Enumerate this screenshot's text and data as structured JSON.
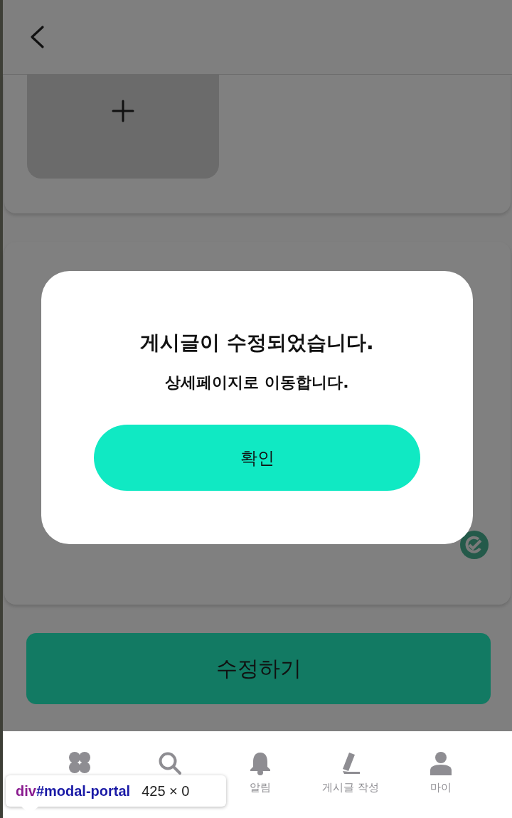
{
  "submit_button": {
    "label": "수정하기"
  },
  "modal": {
    "title": "게시글이 수정되었습니다.",
    "message": "상세페이지로 이동합니다.",
    "confirm": "확인"
  },
  "bottom_nav": [
    {
      "kind": "home"
    },
    {
      "kind": "search"
    },
    {
      "kind": "bell",
      "label": "알림"
    },
    {
      "kind": "pencil",
      "label": "게시글 작성"
    },
    {
      "kind": "person",
      "label": "마이"
    }
  ],
  "inspector_tooltip": {
    "tag": "div",
    "id": "#modal-portal",
    "size": "425 × 0"
  }
}
